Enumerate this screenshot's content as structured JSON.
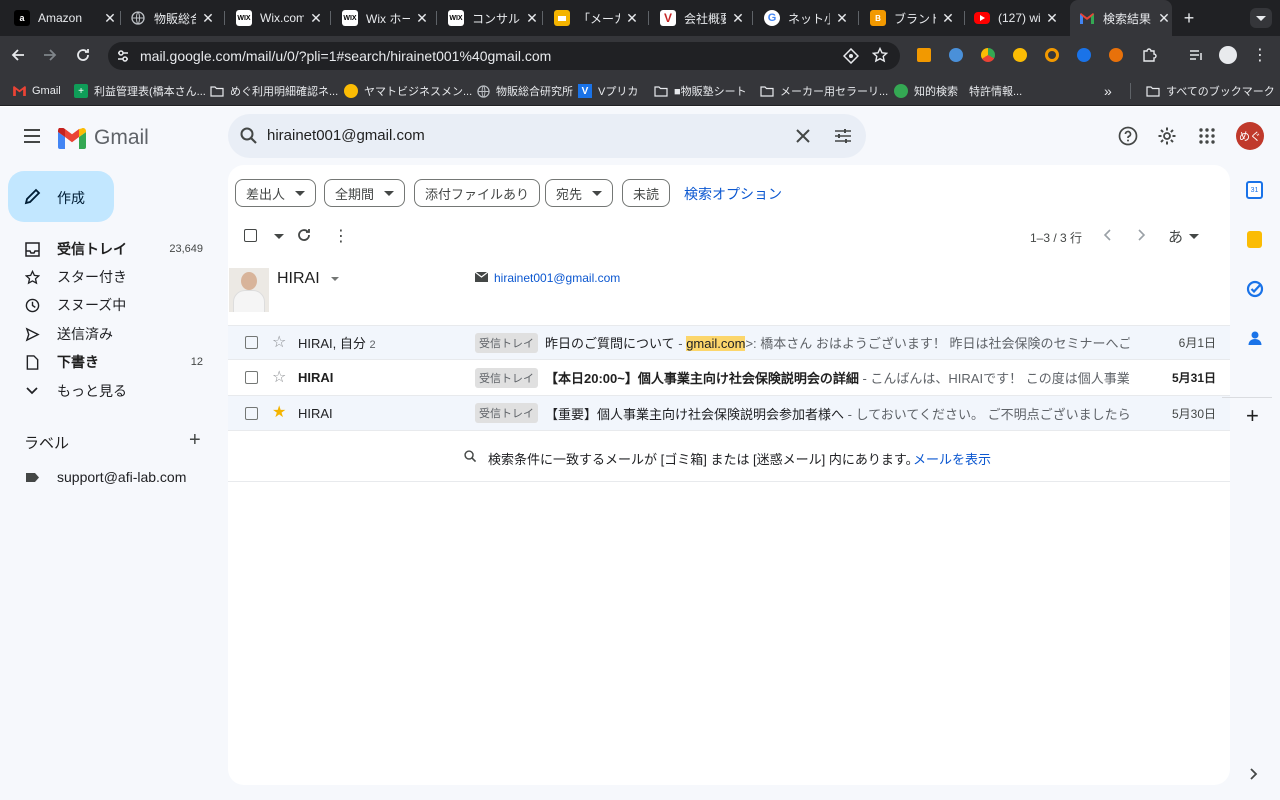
{
  "browser": {
    "tabs": [
      {
        "title": "Amazon",
        "icon": "amazon-icon",
        "color": "#000000"
      },
      {
        "title": "物販総合研",
        "icon": "globe-icon",
        "color": "#9aa0a6"
      },
      {
        "title": "Wix.com",
        "icon": "wix-icon",
        "color": "#000000"
      },
      {
        "title": "Wix ホー",
        "icon": "wix-icon",
        "color": "#000000"
      },
      {
        "title": "コンサル",
        "icon": "wix-icon",
        "color": "#000000"
      },
      {
        "title": "「メーカ",
        "icon": "slides-icon",
        "color": "#f4b400"
      },
      {
        "title": "会社概要",
        "icon": "v-icon",
        "color": "#c62828"
      },
      {
        "title": "ネット小",
        "icon": "google-icon",
        "color": "#ffffff"
      },
      {
        "title": "ブランド",
        "icon": "brand-icon",
        "color": "#f29900"
      },
      {
        "title": "(127) wi",
        "icon": "youtube-icon",
        "color": "#ff0000"
      },
      {
        "title": "検索結果",
        "icon": "gmail-icon",
        "color": "#ea4335"
      }
    ],
    "url": "mail.google.com/mail/u/0/?pli=1#search/hirainet001%40gmail.com",
    "bookmarks": [
      {
        "label": "Gmail",
        "icon": "gmail-icon"
      },
      {
        "label": "利益管理表(橋本さん...",
        "icon": "sheets-icon"
      },
      {
        "label": "めぐ利用明細確認ネ...",
        "icon": "folder-icon"
      },
      {
        "label": "ヤマトビジネスメン...",
        "icon": "yamato-icon"
      },
      {
        "label": "物販総合研究所",
        "icon": "globe-icon"
      },
      {
        "label": "Vプリカ",
        "icon": "v-icon"
      },
      {
        "label": "■物販塾シート",
        "icon": "folder-icon"
      },
      {
        "label": "メーカー用セラーリ...",
        "icon": "folder-icon"
      },
      {
        "label": "知的検索　特許情報...",
        "icon": "chip-icon"
      }
    ],
    "all_bookmarks": "すべてのブックマーク"
  },
  "gmail": {
    "logo_text": "Gmail",
    "search_value": "hirainet001@gmail.com",
    "avatar_text": "めぐ",
    "compose_label": "作成",
    "nav": [
      {
        "label": "受信トレイ",
        "count": "23,649",
        "icon": "inbox-icon",
        "bold": true
      },
      {
        "label": "スター付き",
        "count": "",
        "icon": "star-icon",
        "bold": false
      },
      {
        "label": "スヌーズ中",
        "count": "",
        "icon": "clock-icon",
        "bold": false
      },
      {
        "label": "送信済み",
        "count": "",
        "icon": "send-icon",
        "bold": false
      },
      {
        "label": "下書き",
        "count": "12",
        "icon": "draft-icon",
        "bold": true
      },
      {
        "label": "もっと見る",
        "count": "",
        "icon": "chevron-down-icon",
        "bold": false
      }
    ],
    "labels_title": "ラベル",
    "labels": [
      "support@afi-lab.com"
    ],
    "chips": [
      "差出人",
      "全期間",
      "添付ファイルあり",
      "宛先",
      "未読"
    ],
    "search_options": "検索オプション",
    "pagination": "1–3 / 3 行",
    "input_tool": "あ",
    "contact": {
      "name": "HIRAI",
      "email": "hirainet001@gmail.com"
    },
    "emails": [
      {
        "sender": "HIRAI, 自分",
        "count": "2",
        "label": "受信トレイ",
        "subject": "昨日のご質問について",
        "snippet_pre": " - ",
        "highlight": "gmail.com",
        "snippet": ">: 橋本さん おはようございます！ 昨日は社会保険のセミナーへご参…",
        "date": "6月1日",
        "unread": false,
        "starred": false
      },
      {
        "sender": "HIRAI",
        "count": "",
        "label": "受信トレイ",
        "subject": "【本日20:00~】個人事業主向け社会保険説明会の詳細",
        "snippet_pre": " - ",
        "highlight": "",
        "snippet": "こんばんは、HIRAIです！ この度は個人事業主…",
        "date": "5月31日",
        "unread": true,
        "starred": false
      },
      {
        "sender": "HIRAI",
        "count": "",
        "label": "受信トレイ",
        "subject": "【重要】個人事業主向け社会保険説明会参加者様へ",
        "snippet_pre": " - ",
        "highlight": "",
        "snippet": "しておいてください。 ご不明点ございましたらお…",
        "date": "5月30日",
        "unread": false,
        "starred": true
      }
    ],
    "trash_notice": "検索条件に一致するメールが [ゴミ箱] または [迷惑メール] 内にあります。",
    "show_mail": "メールを表示"
  }
}
